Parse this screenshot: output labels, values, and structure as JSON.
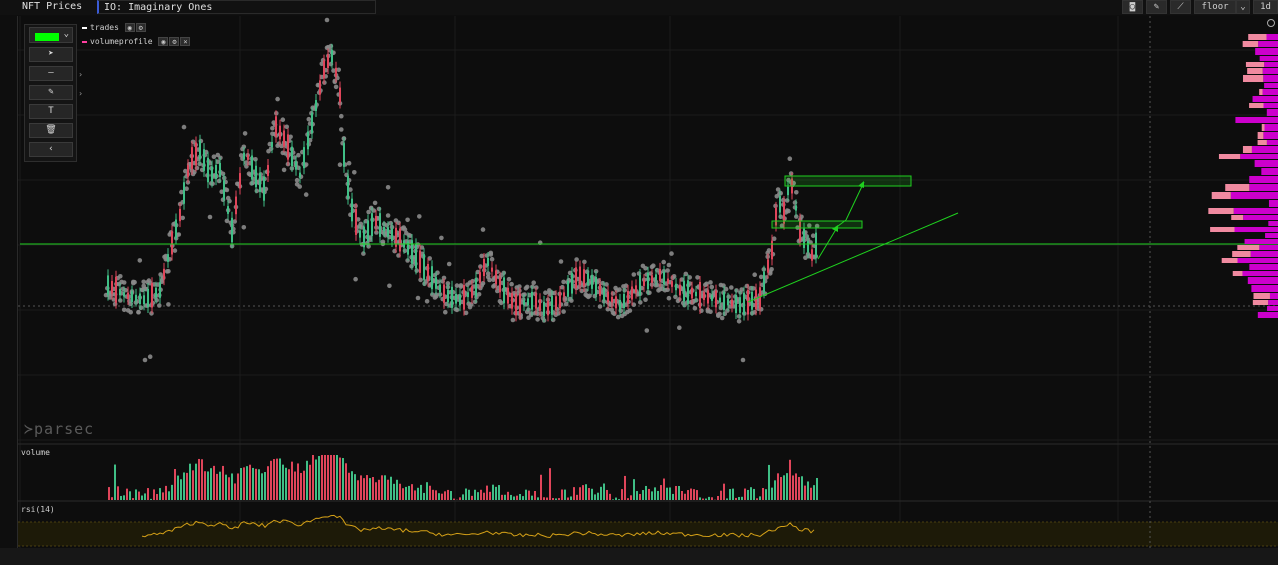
{
  "header": {
    "title": "NFT Prices",
    "collection": "IO: Imaginary Ones",
    "metric": "floor",
    "interval": "1d",
    "icons": [
      "camera-icon",
      "pencil-icon",
      "chart-icon",
      "dropdown-arrow-icon"
    ]
  },
  "toolbox": {
    "color": "#00ff00",
    "tools": [
      "cursor-icon",
      "line-icon",
      "pencil-icon",
      "text-icon",
      "trash-icon",
      "collapse-icon"
    ],
    "text_tool_label": "T"
  },
  "legend": [
    {
      "name": "trades",
      "color": "#ffffff"
    },
    {
      "name": "volumeprofile",
      "color": "#ff3fa0"
    }
  ],
  "panes": {
    "volume_label": "volume",
    "rsi_label": "rsi(14)"
  },
  "watermark": "parsec",
  "colors": {
    "up": "#3fbf86",
    "down": "#e0455a",
    "scatter": "#8a8a8a",
    "drawing": "#1fd11f",
    "rsi": "#d4a017",
    "profile_main": "#cc00cc",
    "profile_alt": "#f08aa0"
  }
}
